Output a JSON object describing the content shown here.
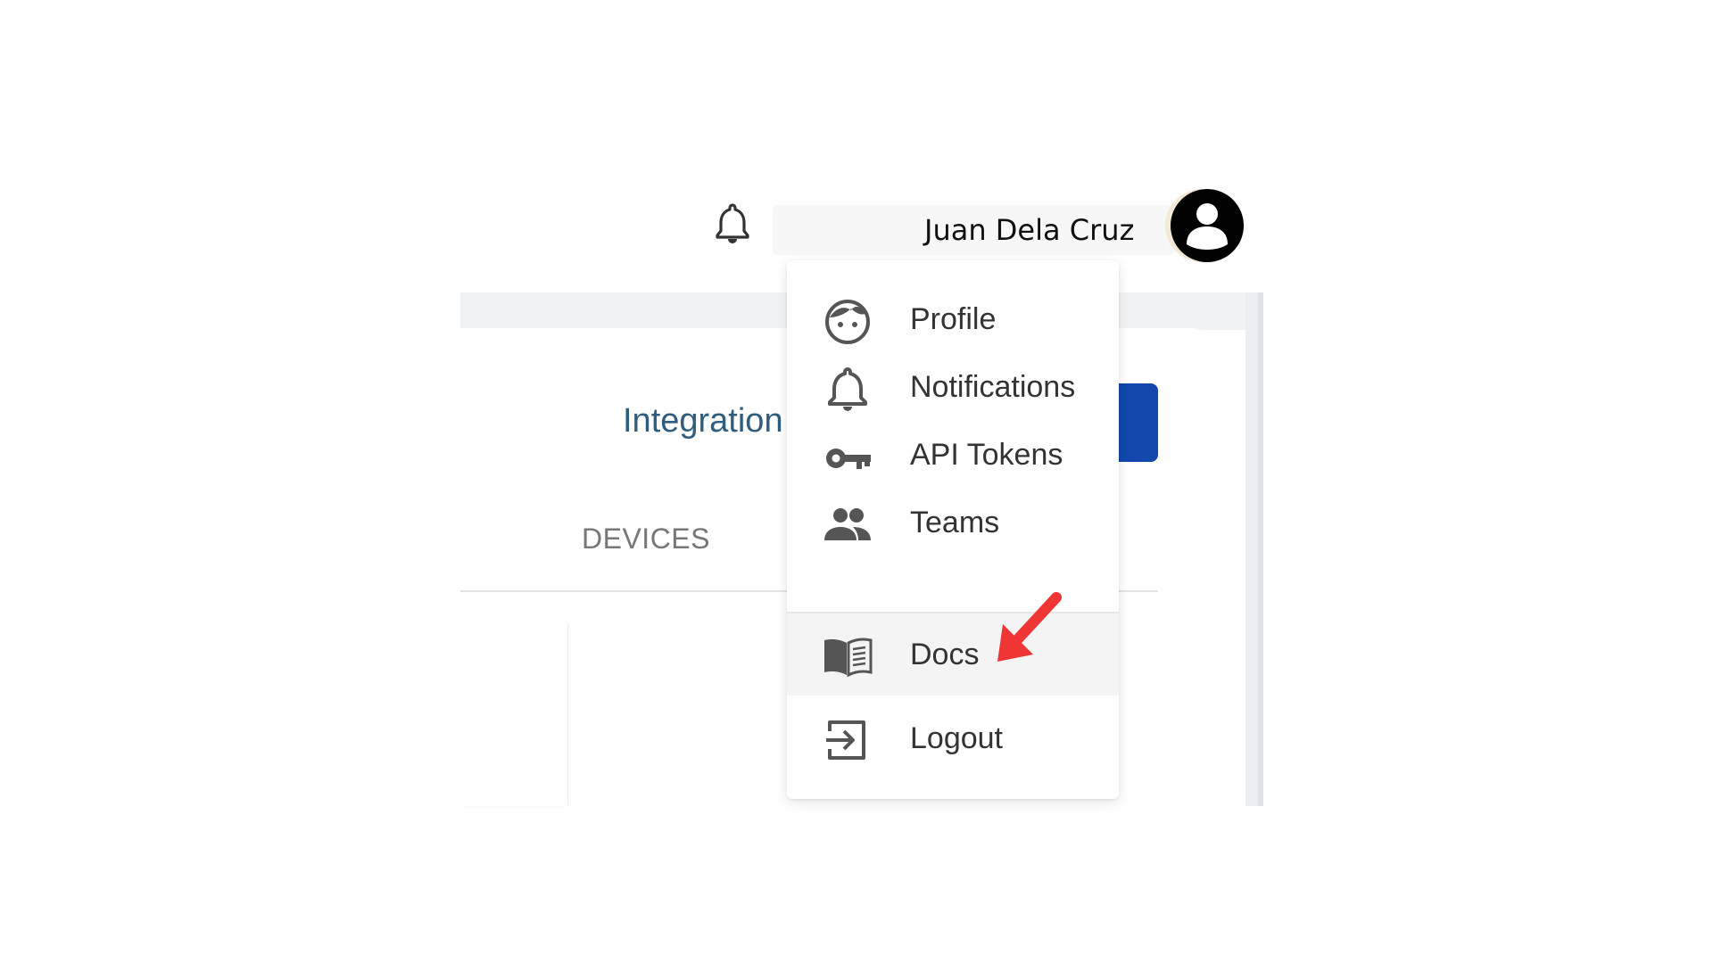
{
  "header": {
    "notification_icon": "bell-icon",
    "user_name": "Juan Dela Cruz",
    "avatar_icon": "user-avatar-icon"
  },
  "app": {
    "title": "Integration",
    "tabs": [
      "DEVICES"
    ]
  },
  "menu": {
    "items": [
      {
        "label": "Profile",
        "icon": "face-icon"
      },
      {
        "label": "Notifications",
        "icon": "bell-icon"
      },
      {
        "label": "API Tokens",
        "icon": "key-icon"
      },
      {
        "label": "Teams",
        "icon": "people-icon"
      },
      {
        "label": "Docs",
        "icon": "book-icon",
        "highlighted": true
      },
      {
        "label": "Logout",
        "icon": "logout-icon"
      }
    ]
  },
  "colors": {
    "primary_button": "#1248ab",
    "title_text": "#2f5d7d",
    "annotation_arrow": "#f03535",
    "menu_hover": "#f4f4f4"
  }
}
